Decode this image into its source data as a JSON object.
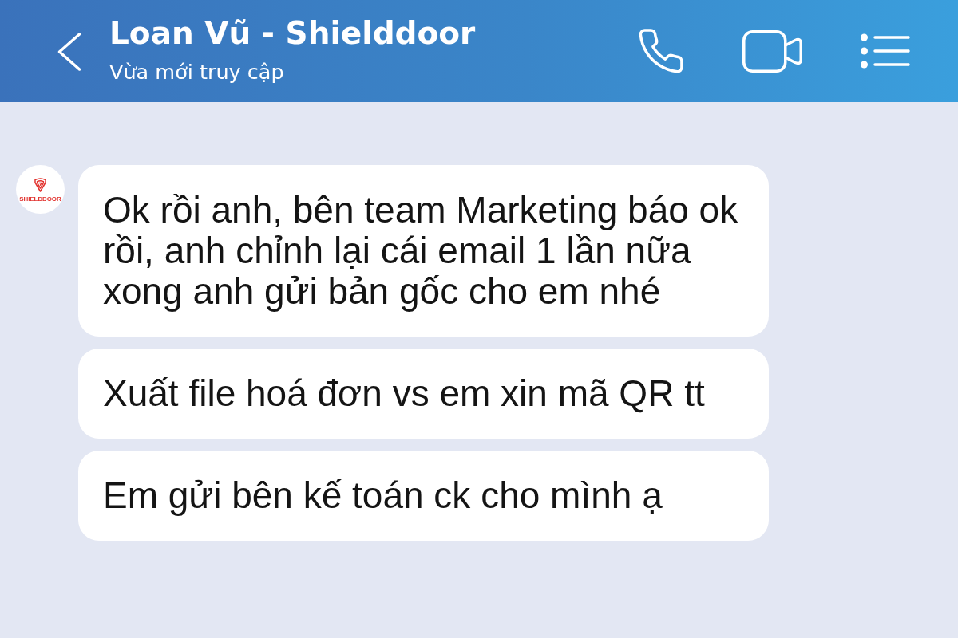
{
  "header": {
    "title": "Loan Vũ - Shielddoor",
    "status": "Vừa mới truy cập"
  },
  "messages": [
    {
      "text": "Ok rồi anh, bên team Marketing báo ok rồi, anh chỉnh lại cái email 1 lần nữa xong anh gửi bản gốc cho em nhé",
      "avatar": {
        "logo_text": "SHIELDDOOR"
      }
    },
    {
      "text": "Xuất file hoá đơn vs em xin mã QR tt"
    },
    {
      "text": "Em gửi bên kế toán ck cho mình ạ"
    }
  ]
}
